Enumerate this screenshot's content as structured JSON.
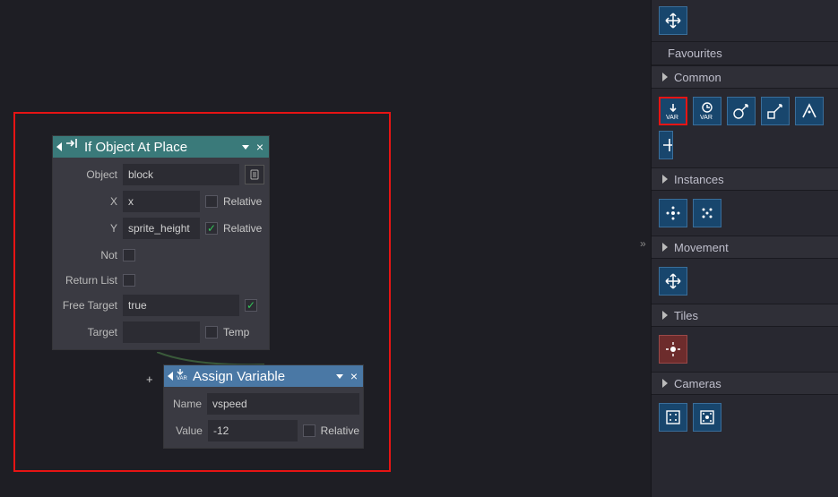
{
  "workspace": {
    "node1": {
      "title": "If Object At Place",
      "fields": {
        "object_label": "Object",
        "object_value": "block",
        "x_label": "X",
        "x_value": "x",
        "x_relative": false,
        "relative_text": "Relative",
        "y_label": "Y",
        "y_value": "sprite_height",
        "y_relative": true,
        "not_label": "Not",
        "returnlist_label": "Return List",
        "freetarget_label": "Free Target",
        "freetarget_value": "true",
        "target_label": "Target",
        "target_value": "",
        "temp_text": "Temp"
      }
    },
    "node2": {
      "title": "Assign Variable",
      "fields": {
        "name_label": "Name",
        "name_value": "vspeed",
        "value_label": "Value",
        "value_value": "-12",
        "relative_text": "Relative"
      }
    },
    "plus": "+"
  },
  "sidebar": {
    "favourites": "Favourites",
    "categories": {
      "common": "Common",
      "instances": "Instances",
      "movement": "Movement",
      "tiles": "Tiles",
      "cameras": "Cameras"
    },
    "icons": {
      "move": "move-icon",
      "var_assign": "var-assign-icon",
      "var_get": "var-get-icon",
      "direction_to": "direction-to-icon",
      "bounce": "bounce-icon",
      "path": "path-icon",
      "arrows": "arrows-icon",
      "instance1": "instance-dots-icon",
      "instance2": "instance-grid-icon",
      "tile": "tile-icon",
      "camera1": "camera-view-icon",
      "camera2": "camera-grid-icon"
    }
  }
}
